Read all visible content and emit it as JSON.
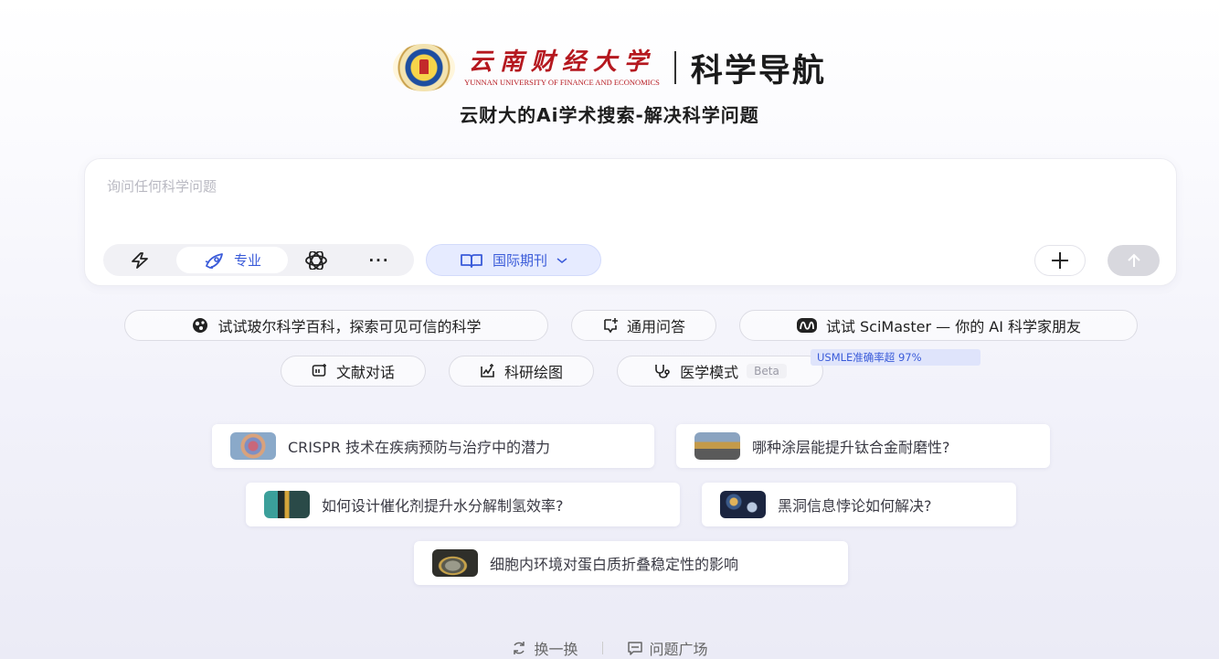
{
  "header": {
    "university_cn": "云南财经大学",
    "university_en": "YUNNAN UNIVERSITY OF FINANCE AND ECONOMICS",
    "brand_title": "科学导航",
    "subtitle": "云财大的Ai学术搜索-解决科学问题"
  },
  "search": {
    "placeholder": "询问任何科学问题",
    "value": "",
    "modes": [
      {
        "icon": "lightning-icon",
        "label": ""
      },
      {
        "icon": "rocket-icon",
        "label": "专业",
        "selected": true
      },
      {
        "icon": "atom-icon",
        "label": ""
      },
      {
        "icon": "more-icon",
        "label": "···"
      }
    ],
    "journal_filter": {
      "icon": "book-icon",
      "label": "国际期刊"
    },
    "add_icon": "plus-icon",
    "send_icon": "arrow-up-icon"
  },
  "features": {
    "row1": [
      {
        "icon": "bohr-icon",
        "label": "试试玻尔科学百科，探索可见可信的科学"
      },
      {
        "icon": "chat-plus-icon",
        "label": "通用问答"
      },
      {
        "icon": "scimaster-icon",
        "label": "试试 SciMaster — 你的 AI 科学家朋友"
      }
    ],
    "row2": [
      {
        "icon": "doc-chat-icon",
        "label": "文献对话"
      },
      {
        "icon": "draw-icon",
        "label": "科研绘图"
      },
      {
        "icon": "stethoscope-icon",
        "label": "医学模式",
        "badge": "Beta"
      }
    ],
    "usmle_tag": "USMLE准确率超 97%"
  },
  "suggestions": [
    {
      "label": "CRISPR 技术在疾病预防与治疗中的潜力"
    },
    {
      "label": "哪种涂层能提升钛合金耐磨性?"
    },
    {
      "label": "如何设计催化剂提升水分解制氢效率?"
    },
    {
      "label": "黑洞信息悖论如何解决?"
    },
    {
      "label": "细胞内环境对蛋白质折叠稳定性的影响"
    }
  ],
  "footer": {
    "refresh_label": "换一换",
    "plaza_label": "问题广场"
  },
  "colors": {
    "accent": "#3a5bd9",
    "brand_red": "#b5181f",
    "chip_border": "#dcdce4",
    "send_disabled": "#d8d8de"
  }
}
